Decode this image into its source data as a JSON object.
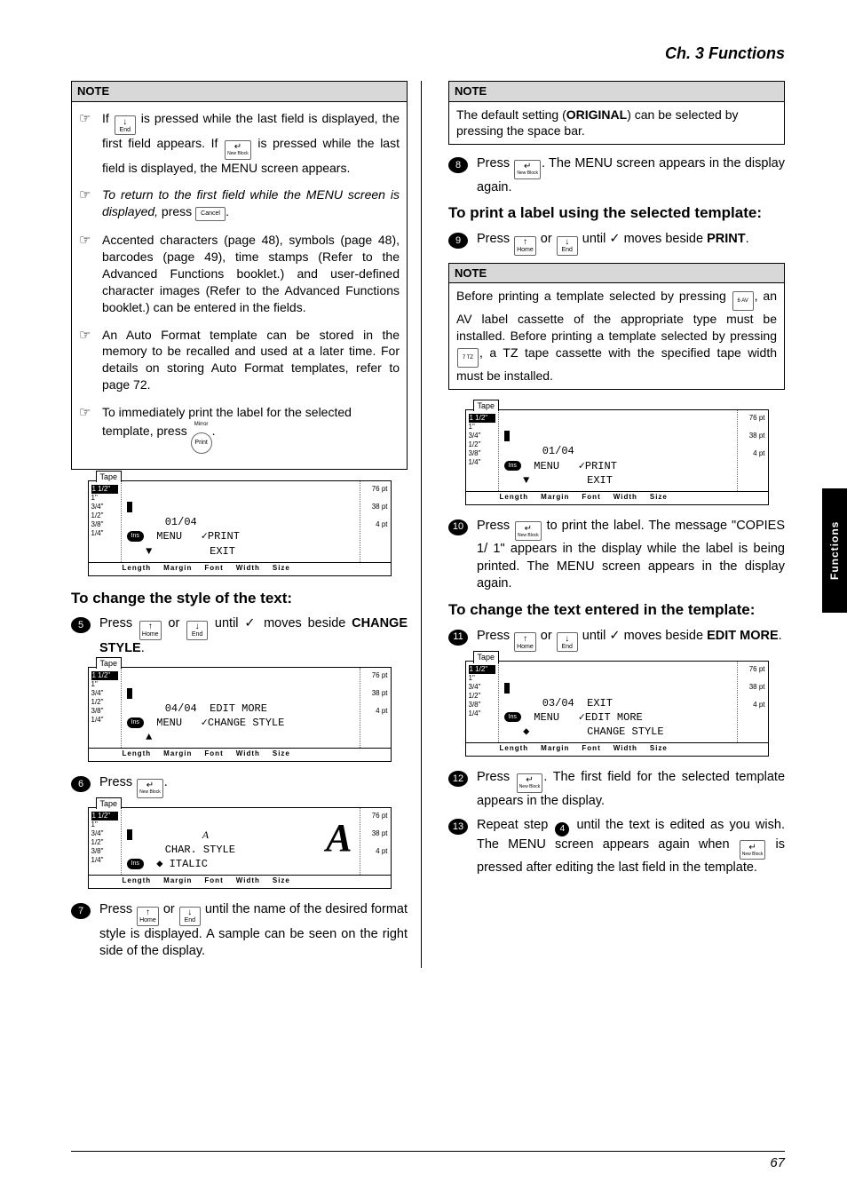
{
  "chapter": "Ch. 3 Functions",
  "side_tab": "Functions",
  "page_number": "67",
  "lcd": {
    "tab": "Tape",
    "left_rows": [
      "1 1/2\"",
      "1\"",
      "3/4\"",
      "1/2\"",
      "3/8\"",
      "1/4\""
    ],
    "right_rows": [
      "76 pt",
      "38 pt",
      "4 pt"
    ],
    "footer_items": [
      "Length",
      "Margin",
      "Font",
      "Width",
      "Size"
    ],
    "ins": "Ins"
  },
  "left": {
    "note_label": "NOTE",
    "note1_line1a": "If ",
    "note1_line1b": " is pressed while the last field is displayed, the first field appears. If ",
    "note1_line1c": " is pressed while the last field is displayed, the MENU screen appears.",
    "note1_b2": "To return to the first field while the MENU screen is displayed,",
    "note1_b2b": " press ",
    "note1_b3": "Accented characters (page 48), symbols (page 48), barcodes (page 49), time stamps (Refer to the Advanced Functions booklet.) and user-defined character images (Refer to the Advanced Functions booklet.) can be entered in the fields.",
    "note1_b4": "An Auto Format template can be stored in the memory to be recalled and used at a later time. For details on storing Auto Format templates, refer to page 72.",
    "note1_b5": "To immediately print the label for the selected template, press ",
    "lcd1_line1": "01/04",
    "lcd1_line2a": "MENU   ",
    "lcd1_line2b": "PRINT",
    "lcd1_line3": "       EXIT",
    "h_change_style": "To change the style of the text:",
    "step5a": "Press ",
    "step5b": " or ",
    "step5c": " until ",
    "step5d": " moves beside ",
    "step5e": "CHANGE STYLE",
    "lcd2_line1": "04/04  EDIT MORE",
    "lcd2_line2a": "MENU   ",
    "lcd2_line2b": "CHANGE STYLE",
    "step6": "Press ",
    "lcd3_topmark": "A",
    "lcd3_line1": "CHAR. STYLE",
    "lcd3_line2": " ITALIC",
    "step7": "Press ",
    "step7b": " or ",
    "step7c": " until the name of the desired format style is displayed. A sample can be seen on the right side of the display."
  },
  "right": {
    "note_label": "NOTE",
    "note2_a": "The default setting (",
    "note2_b": "ORIGINAL",
    "note2_c": ") can be selected by pressing the space bar.",
    "step8a": "Press ",
    "step8b": ". The MENU screen appears in the display again.",
    "h_print": "To print a label using the selected template:",
    "step9a": "Press ",
    "step9b": " or ",
    "step9c": " until ",
    "step9d": " moves beside ",
    "step9e": "PRINT",
    "note3a": "Before printing a template selected by pressing ",
    "note3b": ", an AV label cassette of the appropriate type must be installed. Before printing a template selected by pressing ",
    "note3c": ", a TZ tape cassette with the specified tape width must be installed.",
    "lcd4_line1": "01/04",
    "lcd4_line2a": "MENU   ",
    "lcd4_line2b": "PRINT",
    "lcd4_line3": "       EXIT",
    "step10a": "Press ",
    "step10b": " to print the label. The message \"COPIES 1/ 1\" appears in the display while the label is being printed. The MENU screen appears in the display again.",
    "h_edit": "To change the text entered in the template:",
    "step11a": "Press ",
    "step11b": " or ",
    "step11c": " until ",
    "step11d": " moves beside ",
    "step11e": "EDIT MORE",
    "lcd5_line1": "03/04  EXIT",
    "lcd5_line2a": "MENU   ",
    "lcd5_line2b": "EDIT MORE",
    "lcd5_line3": "       CHANGE STYLE",
    "step12a": "Press ",
    "step12b": ". The first field for the selected template appears in the display.",
    "step13a": "Repeat step ",
    "step13b": " until the text is edited as you wish. The MENU screen appears again when ",
    "step13c": " is pressed after editing the last field in the template."
  },
  "keys": {
    "home": "Home",
    "end": "End",
    "cancel": "Cancel",
    "new_block": "New\nBlock",
    "print": "Print",
    "mirror": "Mirror",
    "av6": "6 AV",
    "tz7": "7 TZ",
    "period": "."
  }
}
